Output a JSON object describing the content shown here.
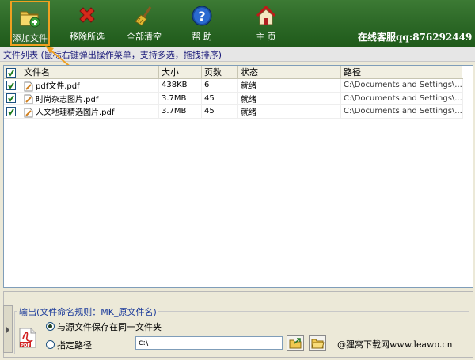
{
  "toolbar": {
    "add_files": "添加文件",
    "remove_selected": "移除所选",
    "clear_all": "全部清空",
    "help": "帮 助",
    "home": "主 页",
    "contact": "在线客服qq:876292449"
  },
  "hint": "文件列表 (鼠标右键弹出操作菜单，支持多选，拖拽排序)",
  "table": {
    "headers": [
      "文件名",
      "大小",
      "页数",
      "状态",
      "路径"
    ],
    "rows": [
      {
        "name": "pdf文件.pdf",
        "size": "438KB",
        "pages": "6",
        "status": "就绪",
        "path": "C:\\Documents and Settings\\..."
      },
      {
        "name": "时尚杂志图片.pdf",
        "size": "3.7MB",
        "pages": "45",
        "status": "就绪",
        "path": "C:\\Documents and Settings\\..."
      },
      {
        "name": "人文地理精选图片.pdf",
        "size": "3.7MB",
        "pages": "45",
        "status": "就绪",
        "path": "C:\\Documents and Settings\\..."
      }
    ]
  },
  "output": {
    "legend": "输出(文件命名规则：MK_原文件名)",
    "same_folder_label": "与源文件保存在同一文件夹",
    "custom_path_label": "指定路径",
    "path_value": "c:\\",
    "selected": "same_folder"
  },
  "credit": "@狸窝下载网www.leawo.cn",
  "colors": {
    "toolbar_bg": "#2e6a28",
    "highlight": "#f0a020",
    "hint_text": "#1a1a7a"
  }
}
